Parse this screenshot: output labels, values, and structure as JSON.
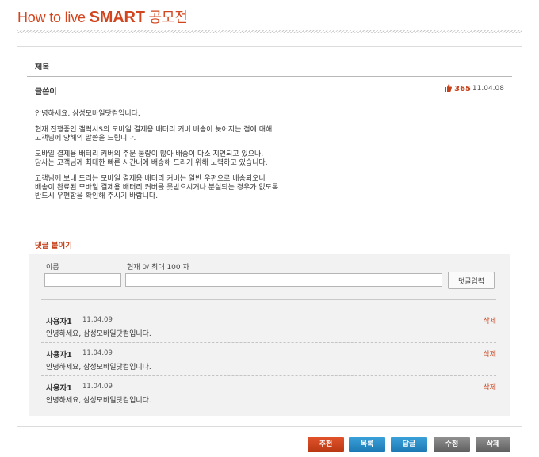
{
  "page_title": {
    "prefix": "How to live ",
    "strong": "SMART",
    "suffix": " 공모전"
  },
  "post": {
    "subject_label": "제목",
    "author_label": "글쓴이",
    "recommend_count": "365",
    "date": "11.04.08",
    "content": [
      "안녕하세요, 삼성모바일닷컴입니다.",
      "현재 진행중인 갤럭시S의 모바일 결제용 배터리 커버 배송이 늦어지는 점에 대해\n고객님께 양해의 말씀을 드립니다.",
      "모바일 결제용 배터리 커버의 주문 물량이 많아 배송이 다소 지연되고 있으나,\n당사는 고객님께 최대한 빠른 시간내에 배송해 드리기 위해 노력하고 있습니다.",
      "고객님께 보내 드리는 모바일 결제용 배터리 커버는 일반 우편으로 배송되오니\n배송이 완료된 모바일 결제용 배터리 커버를 못받으시거나 분실되는 경우가 없도록\n반드시 우편함을 확인해 주시기 바랍니다."
    ]
  },
  "comment_form": {
    "section_title": "댓글 붙이기",
    "name_label": "이름",
    "count_label": "현재 0/ 최대 100 자",
    "name_value": "",
    "text_value": "",
    "submit_label": "덧글입력"
  },
  "comments": [
    {
      "user": "사용자1",
      "date": "11.04.09",
      "text": "안녕하세요, 삼성모바일닷컴입니다.",
      "delete_label": "삭제"
    },
    {
      "user": "사용자1",
      "date": "11.04.09",
      "text": "안녕하세요, 삼성모바일닷컴입니다.",
      "delete_label": "삭제"
    },
    {
      "user": "사용자1",
      "date": "11.04.09",
      "text": "안녕하세요, 삼성모바일닷컴입니다.",
      "delete_label": "삭제"
    }
  ],
  "actions": {
    "recommend": "추천",
    "list": "목록",
    "reply": "답글",
    "edit": "수정",
    "delete": "삭제"
  },
  "colors": {
    "accent": "#c6421a",
    "blue": "#1c78b3",
    "gray": "#6a6a6a"
  },
  "icons": {
    "recommend": "thumbs-up-icon"
  }
}
